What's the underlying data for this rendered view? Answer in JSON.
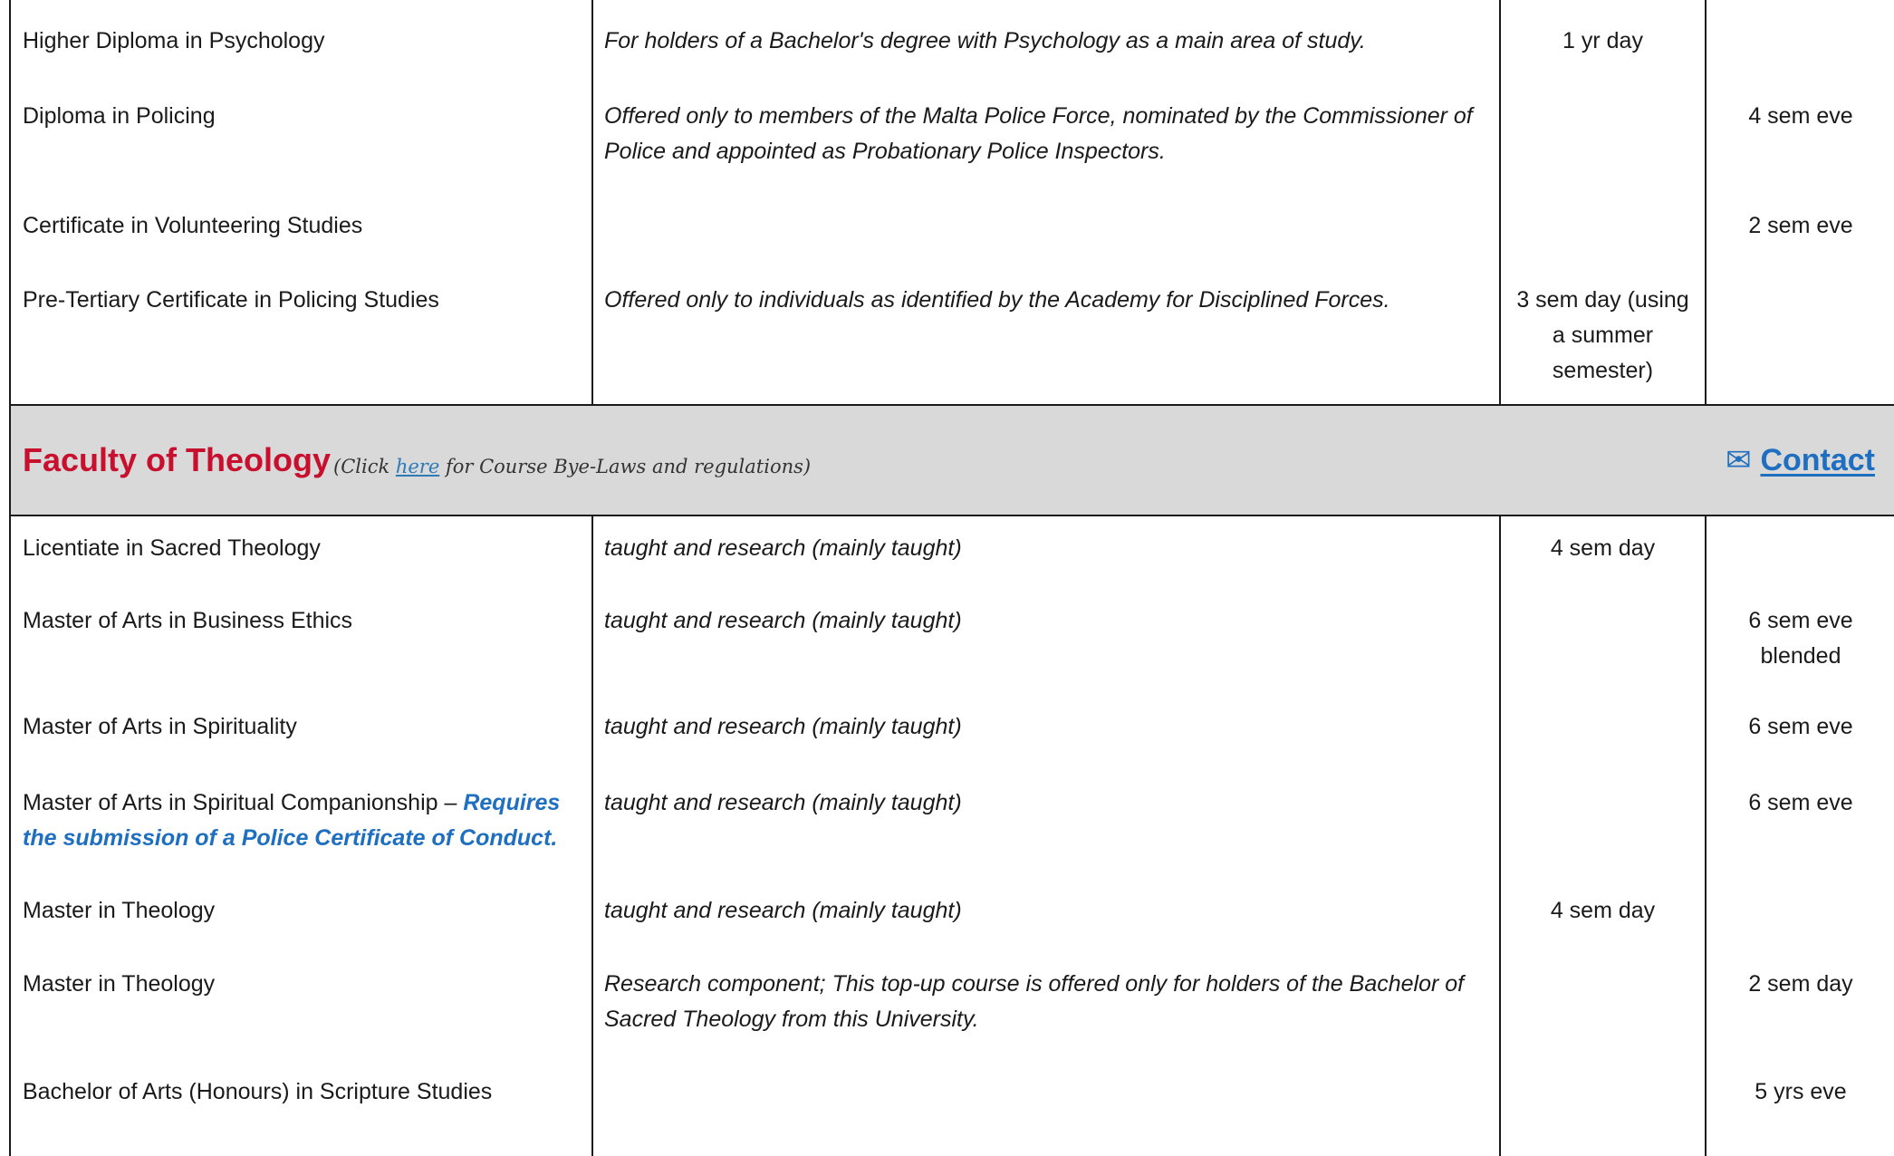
{
  "upper_rows": [
    {
      "name": "Higher Diploma in Psychology",
      "note": "For holders of a Bachelor's degree with Psychology as a main area of study.",
      "day": "1 yr day",
      "eve": ""
    },
    {
      "name": "Diploma in Policing",
      "note": "Offered only to members of the Malta Police Force, nominated by the Commissioner of Police and appointed as Probationary Police Inspectors.",
      "day": "",
      "eve": "4 sem eve"
    },
    {
      "name": "Certificate in Volunteering Studies",
      "note": "",
      "day": "",
      "eve": "2 sem eve"
    },
    {
      "name": "Pre-Tertiary Certificate in Policing Studies",
      "note": "Offered only to individuals as identified by the Academy for Disciplined Forces.",
      "day": "3 sem day (using a summer semester)",
      "eve": ""
    }
  ],
  "section": {
    "title": "Faculty of Theology",
    "note_prefix": "(Click ",
    "note_link": "here",
    "note_suffix": " for Course Bye-Laws and regulations)",
    "contact_icon": "envelope-icon",
    "contact_glyph": "✉",
    "contact_label": "Contact",
    "title_color": "#c8102e",
    "link_color": "#1f6fc1",
    "band_color": "#d9d9d9"
  },
  "theology_rows": [
    {
      "name": "Licentiate in Sacred Theology",
      "note": "taught and research (mainly taught)",
      "day": "4 sem day",
      "eve": ""
    },
    {
      "name": "Master of Arts in Business Ethics",
      "note": "taught and research (mainly taught)",
      "day": "",
      "eve": "6 sem eve blended"
    },
    {
      "name": "Master of Arts in Spirituality",
      "note": "taught and research (mainly taught)",
      "day": "",
      "eve": "6 sem eve"
    },
    {
      "name": "Master of Arts in Spiritual Companionship – ",
      "requirement": "Requires the submission of a Police Certificate of Conduct.",
      "note": "taught and research (mainly taught)",
      "day": "",
      "eve": "6 sem eve"
    },
    {
      "name": "Master in Theology",
      "note": "taught and research (mainly taught)",
      "day": "4 sem day",
      "eve": ""
    },
    {
      "name": "Master in Theology",
      "note": "Research component; This top-up course is offered only for holders of the Bachelor of Sacred Theology from this University.",
      "day": "",
      "eve": "2 sem day"
    },
    {
      "name": "Bachelor of Arts (Honours) in Scripture Studies",
      "note": "",
      "day": "",
      "eve": "5 yrs eve"
    }
  ]
}
